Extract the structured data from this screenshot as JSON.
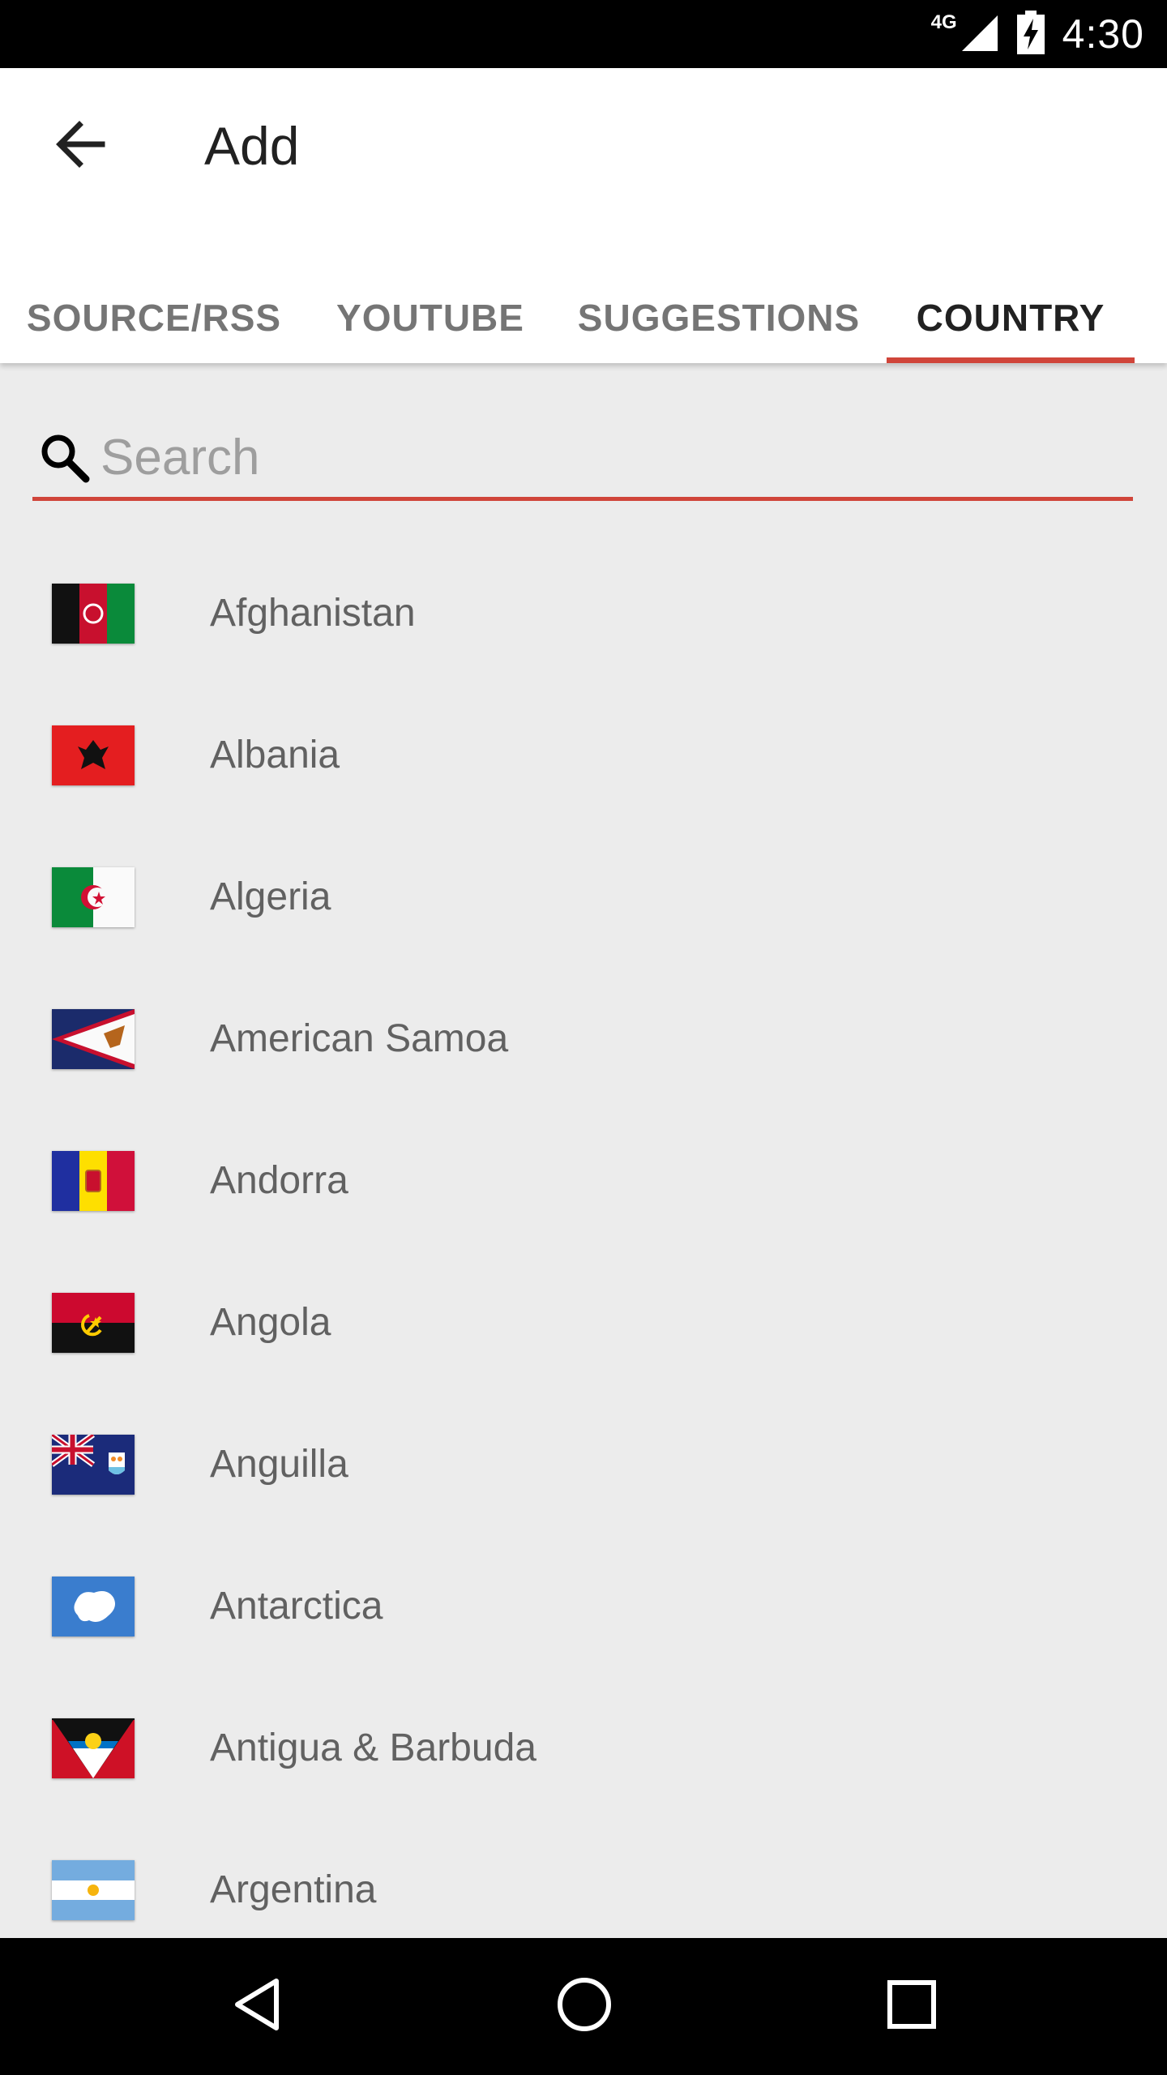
{
  "status_bar": {
    "network": "4G",
    "time": "4:30",
    "icons": [
      "signal-icon",
      "battery-charging-icon"
    ]
  },
  "app_bar": {
    "title": "Add",
    "back_icon": "arrow-left-icon"
  },
  "tabs": [
    {
      "label": "SOURCE/RSS",
      "active": false
    },
    {
      "label": "YOUTUBE",
      "active": false
    },
    {
      "label": "SUGGESTIONS",
      "active": false
    },
    {
      "label": "COUNTRY",
      "active": true
    }
  ],
  "search": {
    "placeholder": "Search",
    "value": "",
    "icon": "search-icon"
  },
  "accent_color": "#d0453a",
  "countries": [
    {
      "name": "Afghanistan",
      "flag": "afghanistan-flag-icon"
    },
    {
      "name": "Albania",
      "flag": "albania-flag-icon"
    },
    {
      "name": "Algeria",
      "flag": "algeria-flag-icon"
    },
    {
      "name": "American Samoa",
      "flag": "american-samoa-flag-icon"
    },
    {
      "name": "Andorra",
      "flag": "andorra-flag-icon"
    },
    {
      "name": "Angola",
      "flag": "angola-flag-icon"
    },
    {
      "name": "Anguilla",
      "flag": "anguilla-flag-icon"
    },
    {
      "name": "Antarctica",
      "flag": "antarctica-flag-icon"
    },
    {
      "name": "Antigua & Barbuda",
      "flag": "antigua-barbuda-flag-icon"
    },
    {
      "name": "Argentina",
      "flag": "argentina-flag-icon"
    }
  ],
  "nav_bar": {
    "icons": [
      "back-triangle-icon",
      "home-circle-icon",
      "recents-square-icon"
    ]
  }
}
